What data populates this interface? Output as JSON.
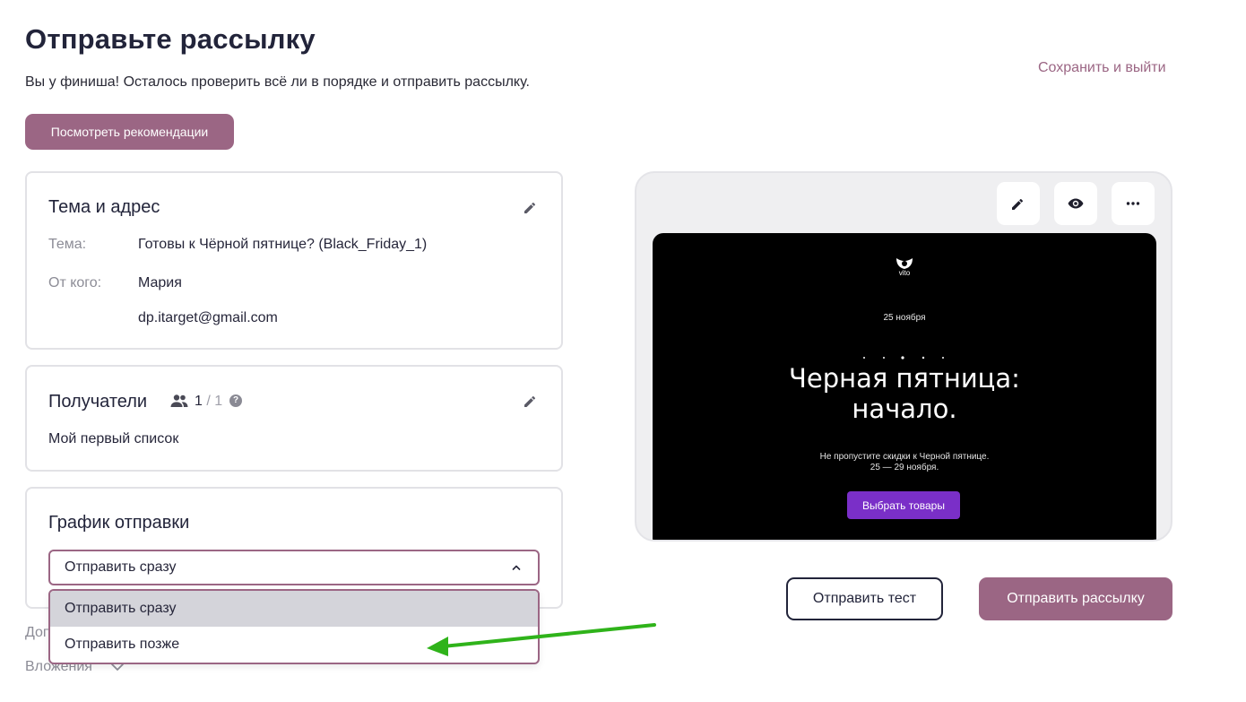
{
  "header": {
    "title": "Отправьте рассылку",
    "subtitle": "Вы у финиша! Осталось проверить всё ли в порядке и отправить рассылку.",
    "save_exit": "Сохранить и выйти",
    "recommendations_button": "Посмотреть рекомендации"
  },
  "subject_card": {
    "title": "Тема и адрес",
    "subject_label": "Тема:",
    "subject_value": "Готовы к Чёрной пятнице? (Black_Friday_1)",
    "from_label": "От кого:",
    "from_name": "Мария",
    "from_email": "dp.itarget@gmail.com"
  },
  "recipients_card": {
    "title": "Получатели",
    "count": "1",
    "total": "/ 1",
    "help": "?",
    "list_name": "Мой первый список"
  },
  "schedule_card": {
    "title": "График отправки",
    "selected": "Отправить сразу",
    "options": [
      "Отправить сразу",
      "Отправить позже"
    ]
  },
  "extra": {
    "additional_partial": "Доп",
    "attachments": "Вложения"
  },
  "preview": {
    "brand": "vito",
    "date": "25 ноября",
    "headline_line1": "Черная пятница:",
    "headline_line2": "начало.",
    "text_line1": "Не пропустите скидки к Черной пятнице.",
    "text_line2": "25 — 29 ноября.",
    "cta": "Выбрать товары"
  },
  "actions": {
    "send_test": "Отправить тест",
    "send_campaign": "Отправить рассылку"
  },
  "colors": {
    "accent": "#9b6684",
    "cta_purple": "#7a2fc8",
    "annotation_green": "#2fb31a"
  }
}
